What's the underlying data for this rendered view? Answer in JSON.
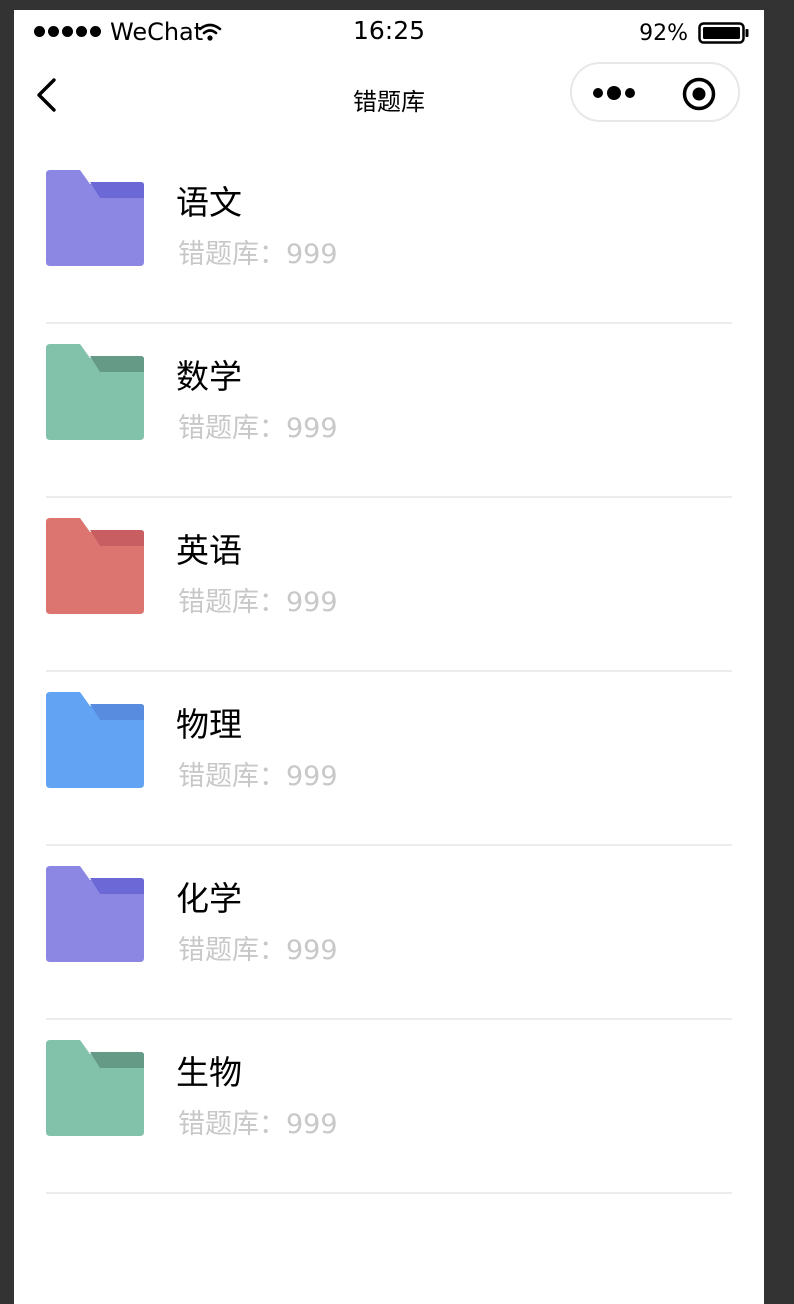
{
  "status_bar": {
    "carrier": "WeChat",
    "time": "16:25",
    "battery": "92%"
  },
  "nav": {
    "title": "错题库"
  },
  "subjects": [
    {
      "name": "语文",
      "count_label": "错题库：",
      "count": "999",
      "color": "#8b87e3",
      "tab_color": "#6c69d6"
    },
    {
      "name": "数学",
      "count_label": "错题库：",
      "count": "999",
      "color": "#82c2aa",
      "tab_color": "#659a86"
    },
    {
      "name": "英语",
      "count_label": "错题库：",
      "count": "999",
      "color": "#dc7470",
      "tab_color": "#c85e62"
    },
    {
      "name": "物理",
      "count_label": "错题库：",
      "count": "999",
      "color": "#63a3f3",
      "tab_color": "#578cdf"
    },
    {
      "name": "化学",
      "count_label": "错题库：",
      "count": "999",
      "color": "#8b87e3",
      "tab_color": "#6c69d6"
    },
    {
      "name": "生物",
      "count_label": "错题库：",
      "count": "999",
      "color": "#82c2aa",
      "tab_color": "#659a86"
    }
  ]
}
